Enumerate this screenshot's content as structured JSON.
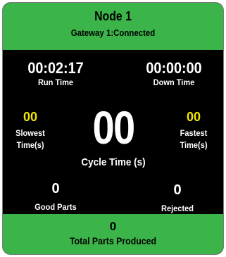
{
  "header": {
    "title": "Node 1",
    "gateway_status": "Gateway 1:Connected"
  },
  "run_time": {
    "value": "00:02:17",
    "label": "Run Time"
  },
  "down_time": {
    "value": "00:00:00",
    "label": "Down Time"
  },
  "slowest": {
    "value": "00",
    "label_line1": "Slowest",
    "label_line2": "Time(s)"
  },
  "fastest": {
    "value": "00",
    "label_line1": "Fastest",
    "label_line2": "Time(s)"
  },
  "cycle": {
    "value": "00",
    "label": "Cycle Time (s)"
  },
  "good_parts": {
    "value": "0",
    "label": "Good Parts"
  },
  "rejected": {
    "value": "0",
    "label": "Rejected"
  },
  "total": {
    "value": "0",
    "label": "Total Parts Produced"
  },
  "colors": {
    "header_green": "#3bb54a",
    "panel_black": "#000000",
    "accent_yellow": "#f2e600"
  }
}
